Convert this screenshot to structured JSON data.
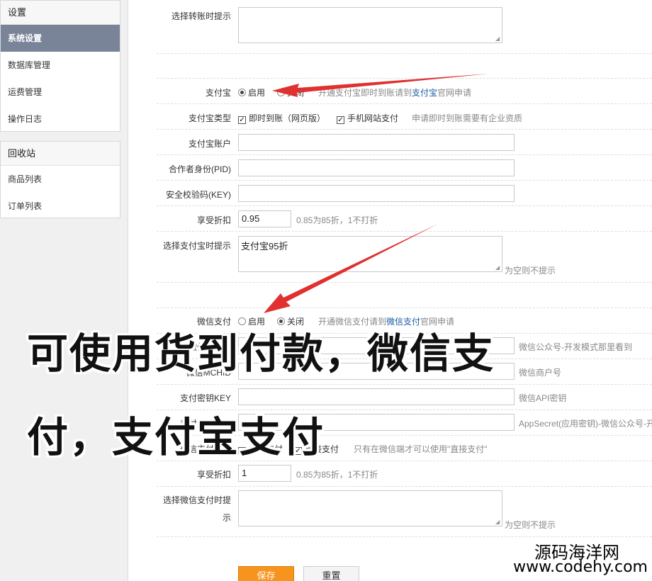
{
  "sidebar": {
    "group1_title": "设置",
    "group1_items": [
      "系统设置",
      "数据库管理",
      "运费管理",
      "操作日志"
    ],
    "group2_title": "回收站",
    "group2_items": [
      "商品列表",
      "订单列表"
    ]
  },
  "form": {
    "transfer_tip_label": "选择转账时提示",
    "alipay_label": "支付宝",
    "alipay_on": "启用",
    "alipay_off": "关闭",
    "alipay_hint_pre": "开通支付宝即时到账请到",
    "alipay_hint_link": "支付宝",
    "alipay_hint_post": "官网申请",
    "alipay_type_label": "支付宝类型",
    "alipay_type_opt1": "即时到账（网页版）",
    "alipay_type_opt2": "手机网站支付",
    "alipay_type_hint": "申请即时到账需要有企业资质",
    "alipay_account_label": "支付宝账户",
    "pid_label": "合作者身份(PID)",
    "key_label": "安全校验码(KEY)",
    "discount_label": "享受折扣",
    "alipay_discount_value": "0.95",
    "discount_hint": "0.85为85折，1不打折",
    "alipay_tip_label": "选择支付宝时提示",
    "alipay_tip_value": "支付宝95折",
    "empty_hint": "为空则不提示",
    "wechat_label": "微信支付",
    "wechat_on": "启用",
    "wechat_off": "关闭",
    "wechat_hint_pre": "开通微信支付请到",
    "wechat_hint_link": "微信支付",
    "wechat_hint_post": "官网申请",
    "appid_label": "微信APPID",
    "appid_hint": "微信公众号-开发模式那里看到",
    "mchid_label": "微信MCHID",
    "mchid_hint": "微信商户号",
    "paykey_label": "支付密钥KEY",
    "paykey_hint": "微信API密钥",
    "appsecret_label": "支付应用密钥",
    "appsecret_hint": "AppSecret(应用密钥)-微信公众号-开",
    "wechat_type_label": "微信支付类型",
    "wechat_type_opt1": "扫码支付",
    "wechat_type_opt2": "直接支付",
    "wechat_type_hint": "只有在微信端才可以使用\"直接支付\"",
    "wechat_discount_value": "1",
    "wechat_tip_label_1": "选择微信支付时提",
    "wechat_tip_label_2": "示",
    "save_label": "保存",
    "reset_label": "重置"
  },
  "overlay": {
    "line1": "可使用货到付款，微信支",
    "line2": "付，支付宝支付"
  },
  "watermark": {
    "line1": "源码海洋网",
    "line2": "www.codehy.com"
  },
  "colors": {
    "sidebar_active": "#7a8499",
    "save_button": "#f7941d",
    "link": "#1a5aa6",
    "arrow": "#e03030"
  }
}
